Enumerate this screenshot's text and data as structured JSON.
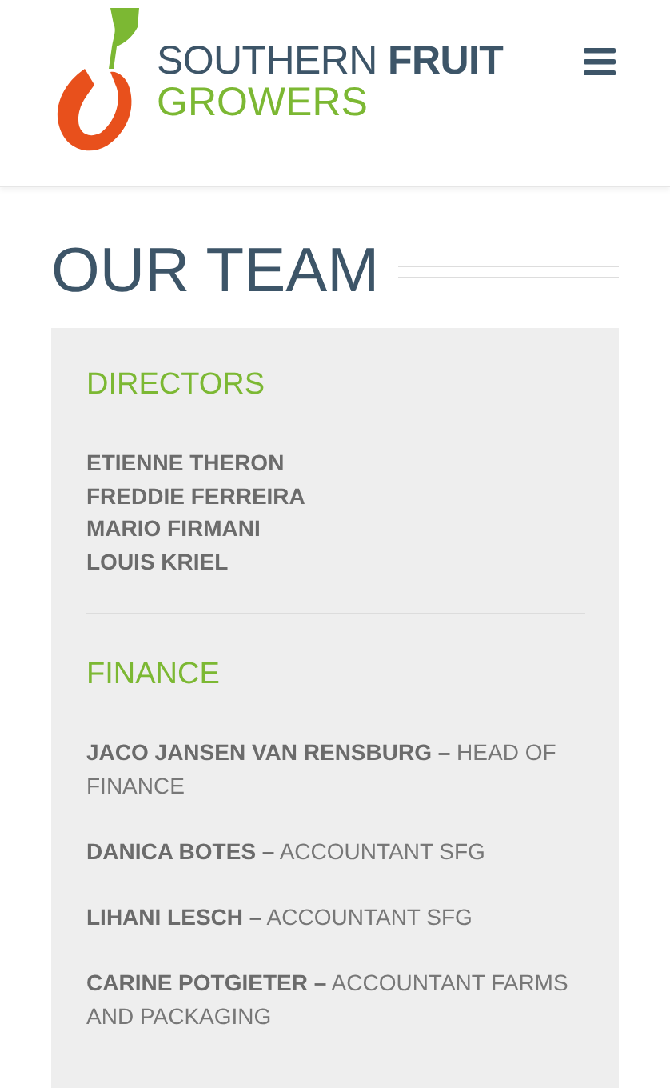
{
  "header": {
    "logo_line_1": "SOUTHERN **FRUIT**",
    "logo_line_2": "GROWERS"
  },
  "page_title": "OUR TEAM",
  "sections": [
    {
      "heading": "DIRECTORS",
      "kind": "names",
      "members": [
        "ETIENNE THERON",
        "FREDDIE FERREIRA",
        "MARIO FIRMANI",
        "LOUIS KRIEL"
      ]
    },
    {
      "heading": "FINANCE",
      "kind": "roles",
      "members": [
        "**JACO JANSEN VAN RENSBURG –** HEAD OF FINANCE",
        "**DANICA BOTES –** ACCOUNTANT SFG",
        "**LIHANI LESCH –** ACCOUNTANT SFG",
        "**CARINE POTGIETER  –** ACCOUNTANT FARMS AND PACKAGING"
      ]
    }
  ]
}
